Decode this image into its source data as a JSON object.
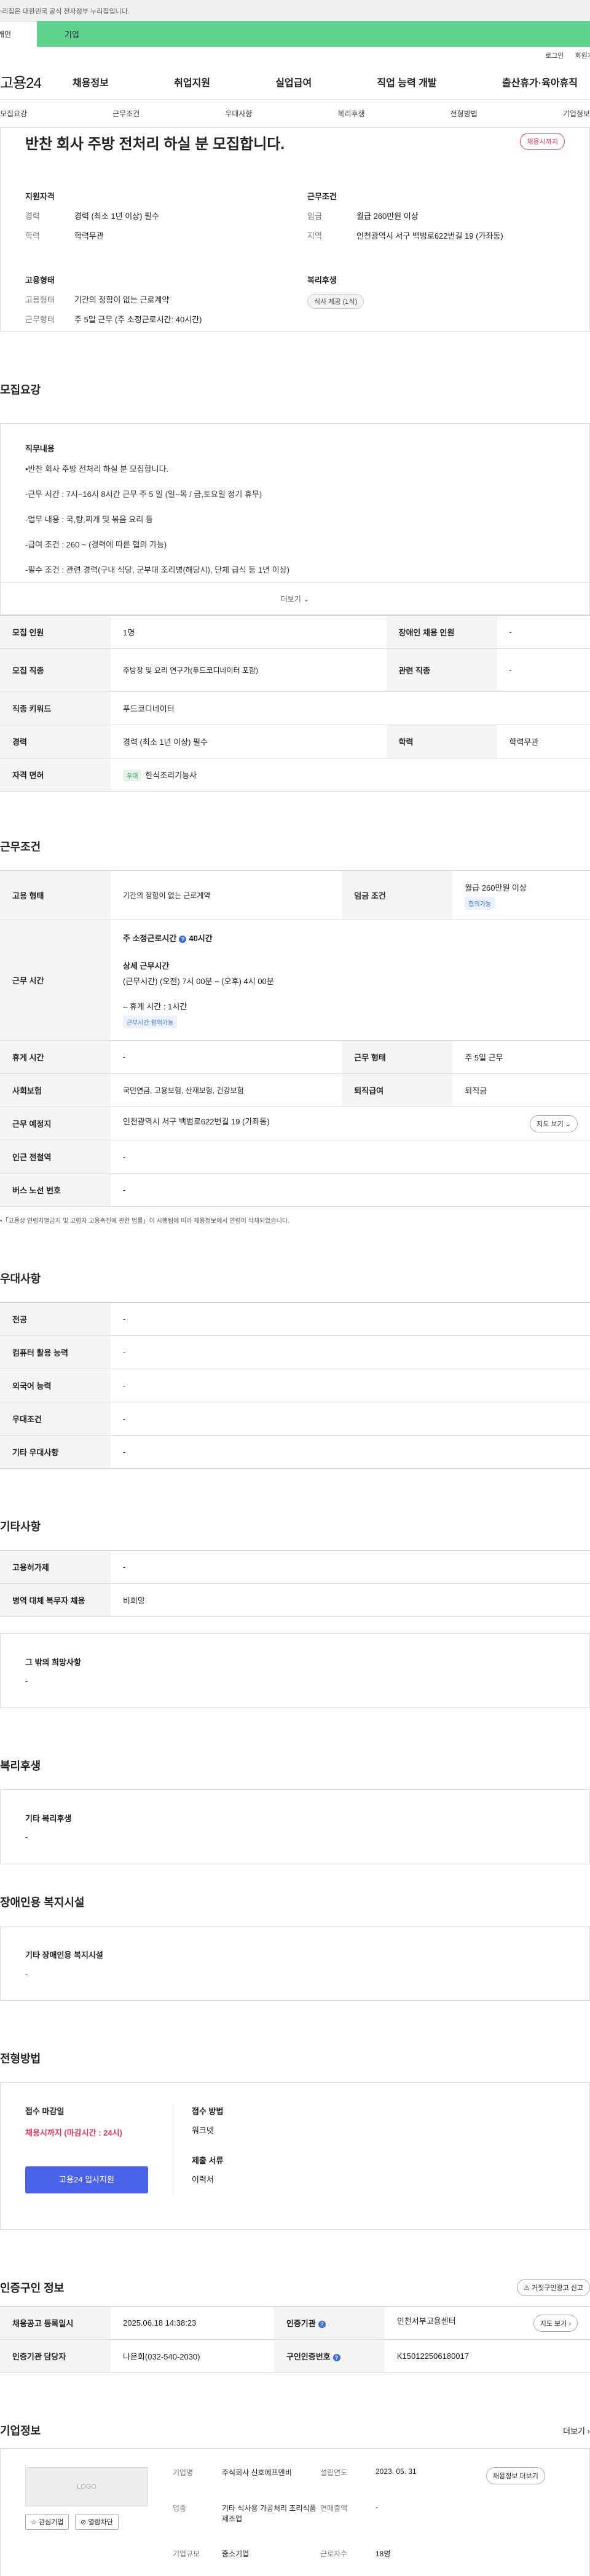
{
  "gov_banner": "이 누리집은 대한민국 공식 전자정부 누리집입니다.",
  "service_tabs": {
    "person": "개인",
    "company": "기업"
  },
  "util": {
    "login": "로그인",
    "signup": "회원가입"
  },
  "logo": "고용24",
  "gnb": [
    "채용정보",
    "취업지원",
    "실업급여",
    "직업 능력 개발",
    "출산휴가·육아휴직"
  ],
  "sub_nav": [
    "모집요강",
    "근무조건",
    "우대사항",
    "복리후생",
    "전형방법",
    "기업정보"
  ],
  "summary": {
    "title": "반찬 회사 주방 전처리 하실 분 모집합니다.",
    "status": "채용시까지",
    "requirements_title": "지원자격",
    "career_k": "경력",
    "career_v": "경력 (최소 1년 이상) 필수",
    "edu_k": "학력",
    "edu_v": "학력무관",
    "employ_title": "고용형태",
    "emptype_k": "고용형태",
    "emptype_v": "기간의 정함이 없는 근로계약",
    "worktype_k": "근무형태",
    "worktype_v": "주 5일 근무 (주 소정근로시간: 40시간)",
    "conditions_title": "근무조건",
    "wage_k": "임금",
    "wage_v": "월급 260만원 이상",
    "region_k": "지역",
    "region_v": "인천광역시 서구 백범로622번길 19 (가좌동)",
    "welfare_title": "복리후생",
    "welfare_chip": "식사 제공 (1식)"
  },
  "recruit": {
    "title": "모집요강",
    "detail_label": "직무내용",
    "lines": [
      "•반찬 회사 주방 전처리 하실 분 모집합니다.",
      "-근무 시간 : 7시~16시 8시간 근무 주 5 일 (일~목 / 금,토요일 정기 휴무)",
      "-업무 내용 : 국,탕,찌개 및 볶음 요리 등",
      "-급여 조건 : 260 ~ (경력에 따른 협의 가능)",
      "-필수 조건 : 관련 경력(구내 식당, 군부대 조리병(해당시), 단체 급식 등 1년 이상)"
    ],
    "more": "더보기",
    "rows": {
      "count_k": "모집 인원",
      "count_v": "1명",
      "disabled_k": "장애인 채용 인원",
      "disabled_v": "-",
      "job_k": "모집 직종",
      "job_v": "주방장 및 요리 연구가(푸드코디네이터 포함)",
      "related_k": "관련 직종",
      "related_v": "-",
      "keyword_k": "직종 키워드",
      "keyword_v": "푸드코디네이터",
      "career_k": "경력",
      "career_v": "경력 (최소 1년 이상) 필수",
      "edu_k": "학력",
      "edu_v": "학력무관",
      "license_k": "자격 면허",
      "license_badge": "우대",
      "license_v": "한식조리기능사"
    }
  },
  "conditions": {
    "title": "근무조건",
    "emptype_k": "고용 형태",
    "emptype_v": "기간의 정함이 없는 근로계약",
    "wage_k": "임금 조건",
    "wage_v": "월급 260만원 이상",
    "wage_tag": "협의가능",
    "hours_k": "근무 시간",
    "weekly_label": "주 소정근로시간",
    "weekly_v": "40시간",
    "detail_title": "상세 근무시간",
    "detail_v": "(근무시간) (오전) 7시 00분 ~ (오후) 4시 00분",
    "break_v": "– 휴게 시간 : 1시간",
    "hours_tag": "근무시간 협의가능",
    "rest_k": "휴게 시간",
    "rest_v": "-",
    "worktype_k": "근무 형태",
    "worktype_v": "주 5일 근무",
    "insurance_k": "사회보험",
    "insurance_v": "국민연금, 고용보험, 산재보험, 건강보험",
    "pension_k": "퇴직급여",
    "pension_v": "퇴직금",
    "place_k": "근무 예정지",
    "place_v": "인천광역시 서구 백범로622번길 19 (가좌동)",
    "map_btn": "지도 보기",
    "subway_k": "인근 전철역",
    "subway_v": "-",
    "bus_k": "버스 노선 번호",
    "bus_v": "-",
    "note": "•「고용상 연령차별금지 및 고령자 고용촉진에 관한 법률」이 시행됨에 따라 채용정보에서 연령이 삭제되었습니다."
  },
  "preferred": {
    "title": "우대사항",
    "rows": [
      {
        "k": "전공",
        "v": "-"
      },
      {
        "k": "컴퓨터 활용 능력",
        "v": "-"
      },
      {
        "k": "외국어 능력",
        "v": "-"
      },
      {
        "k": "우대조건",
        "v": "-"
      },
      {
        "k": "기타 우대사항",
        "v": "-"
      }
    ]
  },
  "etc": {
    "title": "기타사항",
    "rows": [
      {
        "k": "고용허가제",
        "v": "-"
      },
      {
        "k": "병역 대체 복무자 채용",
        "v": "비희망"
      }
    ],
    "other_label": "그 밖의 희망사항",
    "other_v": "-"
  },
  "welfare": {
    "title": "복리후생",
    "label": "기타 복리후생",
    "v": "-"
  },
  "disabled_fac": {
    "title": "장애인용 복지시설",
    "label": "기타 장애인용 복지시설",
    "v": "-"
  },
  "selection": {
    "title": "전형방법",
    "deadline_label": "접수 마감일",
    "deadline_v": "채용시까지 (마감시간 : 24시)",
    "apply_btn": "고용24 입사지원",
    "method_label": "접수 방법",
    "method_v": "워크넷",
    "docs_label": "제출 서류",
    "docs_v": "이력서"
  },
  "cert": {
    "title": "인증구인 정보",
    "report_btn": "거짓구인광고 신고",
    "reg_k": "채용공고 등록일시",
    "reg_v": "2025.06.18 14:38:23",
    "agency_k": "인증기관",
    "agency_v": "인천서부고용센터",
    "map_btn": "지도 보기",
    "manager_k": "인증기관 담당자",
    "manager_v": "나은희(032-540-2030)",
    "certno_k": "구인인증번호",
    "certno_v": "K150122506180017"
  },
  "company": {
    "title": "기업정보",
    "more": "더보기",
    "logo": "LOGO",
    "fav_btn": "관심기업",
    "block_btn": "열람차단",
    "name_k": "기업명",
    "name_v": "주식회사 신호에프엔비",
    "industry_k": "업종",
    "industry_v": "기타 식사용 가공처리 조리식품 제조업",
    "size_k": "기업규모",
    "size_v": "중소기업",
    "founded_k": "설립연도",
    "founded_v": "2023. 05. 31",
    "sales_k": "연매출액",
    "sales_v": "-",
    "staff_k": "근로자수",
    "staff_v": "18명",
    "job_info_btn": "채용정보 더보기"
  }
}
